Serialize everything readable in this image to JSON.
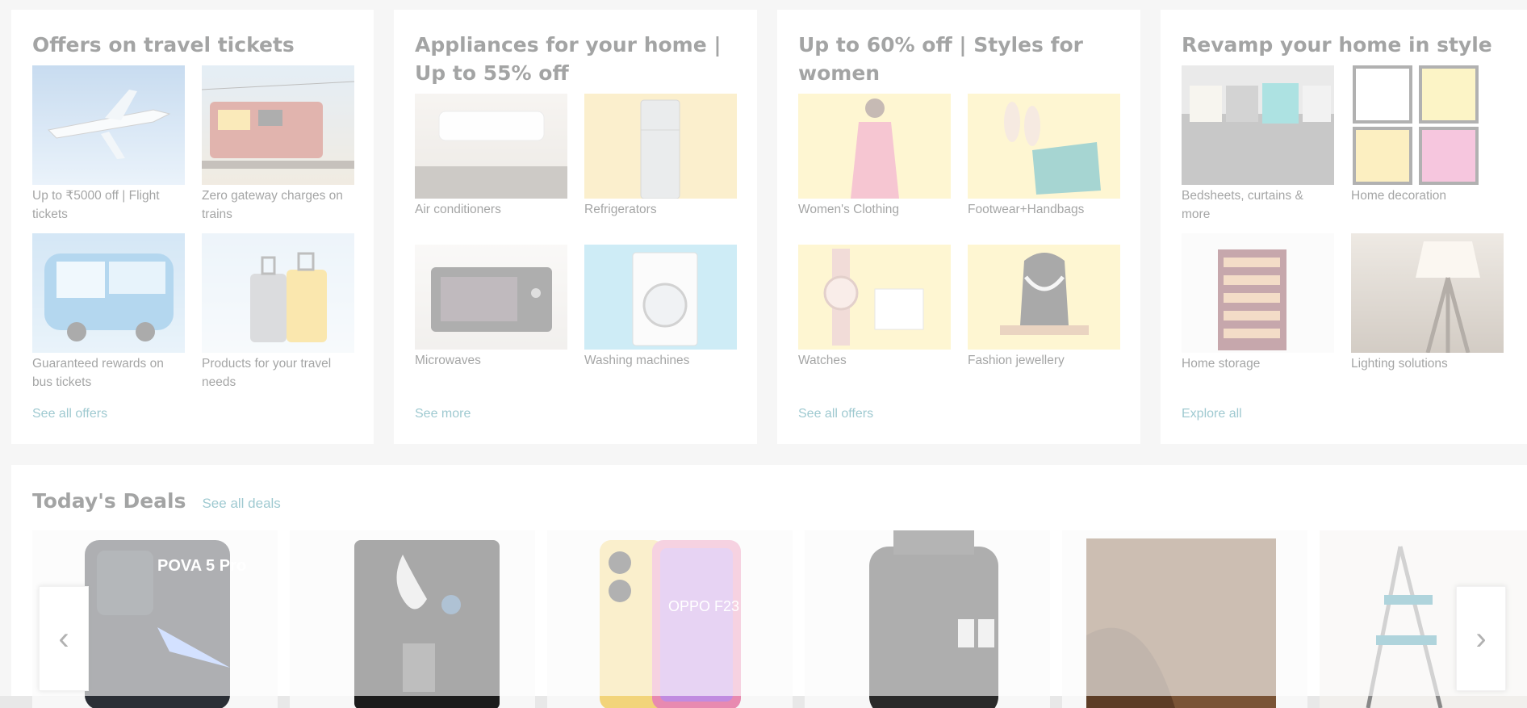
{
  "cards": [
    {
      "title": "Offers on travel tickets",
      "tiles": [
        {
          "label": "Up to ₹5000 off | Flight tickets",
          "icon": "airplane-image"
        },
        {
          "label": "Zero gateway charges on trains",
          "icon": "train-image"
        },
        {
          "label": "Guaranteed rewards on bus tickets",
          "icon": "bus-image"
        },
        {
          "label": "Products for your travel needs",
          "icon": "luggage-image"
        }
      ],
      "link": "See all offers"
    },
    {
      "title": "Appliances for your home | Up to 55% off",
      "tiles": [
        {
          "label": "Air conditioners",
          "icon": "ac-image"
        },
        {
          "label": "Refrigerators",
          "icon": "fridge-image"
        },
        {
          "label": "Microwaves",
          "icon": "microwave-image"
        },
        {
          "label": "Washing machines",
          "icon": "washing-machine-image"
        }
      ],
      "link": "See more"
    },
    {
      "title": "Up to 60% off | Styles for women",
      "tiles": [
        {
          "label": "Women's Clothing",
          "icon": "clothing-image"
        },
        {
          "label": "Footwear+Handbags",
          "icon": "footwear-image"
        },
        {
          "label": "Watches",
          "icon": "watch-image"
        },
        {
          "label": "Fashion jewellery",
          "icon": "jewellery-image"
        }
      ],
      "link": "See all offers"
    },
    {
      "title": "Revamp your home in style",
      "tiles": [
        {
          "label": "Bedsheets, curtains & more",
          "icon": "sofa-image"
        },
        {
          "label": "Home decoration",
          "icon": "frames-image"
        },
        {
          "label": "Home storage",
          "icon": "shoe-rack-image"
        },
        {
          "label": "Lighting solutions",
          "icon": "lamp-image"
        }
      ],
      "link": "Explore all"
    }
  ],
  "deals": {
    "title": "Today's Deals",
    "link": "See all deals",
    "items": [
      {
        "icon": "phone-pova-image",
        "text": "POVA 5 Pro"
      },
      {
        "icon": "water-purifier-image"
      },
      {
        "icon": "phone-oppo-image",
        "text": "OPPO F23"
      },
      {
        "icon": "travel-adapter-image"
      },
      {
        "icon": "wood-wallpaper-image"
      },
      {
        "icon": "ladder-image"
      }
    ],
    "prev_icon": "‹",
    "next_icon": "›"
  }
}
